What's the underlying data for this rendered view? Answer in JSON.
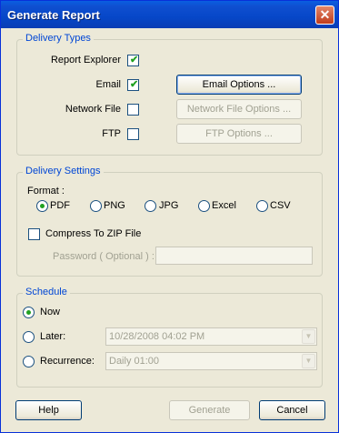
{
  "window": {
    "title": "Generate Report",
    "close_symbol": "✕"
  },
  "delivery_types": {
    "legend": "Delivery Types",
    "items": [
      {
        "label": "Report Explorer",
        "checked": true
      },
      {
        "label": "Email",
        "checked": true,
        "button": "Email Options ...",
        "button_enabled": true
      },
      {
        "label": "Network File",
        "checked": false,
        "button": "Network File Options ...",
        "button_enabled": false
      },
      {
        "label": "FTP",
        "checked": false,
        "button": "FTP Options ...",
        "button_enabled": false
      }
    ]
  },
  "delivery_settings": {
    "legend": "Delivery Settings",
    "format_label": "Format :",
    "formats": [
      "PDF",
      "PNG",
      "JPG",
      "Excel",
      "CSV"
    ],
    "selected_format": "PDF",
    "compress_label": "Compress To  ZIP File",
    "compress_checked": false,
    "password_label": "Password ( Optional ) :",
    "password_value": ""
  },
  "schedule": {
    "legend": "Schedule",
    "options": [
      {
        "label": "Now",
        "selected": true
      },
      {
        "label": "Later:",
        "selected": false,
        "value": "10/28/2008 04:02 PM"
      },
      {
        "label": "Recurrence:",
        "selected": false,
        "value": "Daily 01:00"
      }
    ]
  },
  "footer": {
    "help": "Help",
    "generate": "Generate",
    "cancel": "Cancel"
  },
  "check_glyph": "✔"
}
